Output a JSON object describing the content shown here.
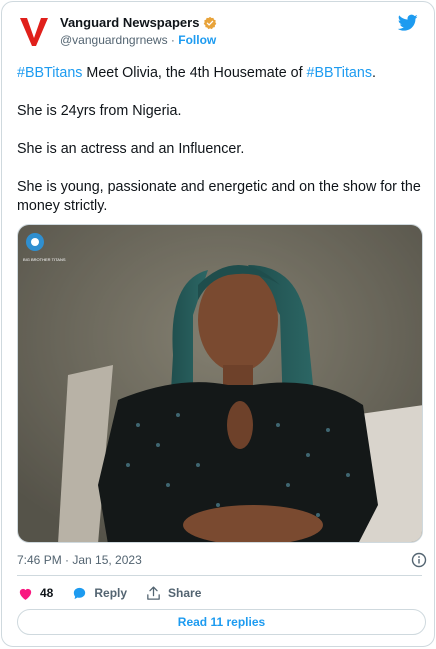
{
  "tweet": {
    "author_name": "Vanguard Newspapers",
    "handle": "@vanguardngrnews",
    "separator": "·",
    "follow_label": "Follow",
    "hashtag": "#BBTitans",
    "first_line_middle": " Meet Olivia, the 4th Housemate of ",
    "first_line_end": ".",
    "paragraphs": [
      "She is 24yrs from Nigeria.",
      "She is an actress and an Influencer.",
      "She is young, passionate and energetic and on the show for the money strictly."
    ],
    "media_watermark": "BIG BROTHER TITANS",
    "timestamp": "7:46 PM · Jan 15, 2023",
    "likes_count": "48",
    "reply_label": "Reply",
    "share_label": "Share",
    "read_replies_label": "Read 11 replies"
  },
  "colors": {
    "brand_red": "#e0201b",
    "link_blue": "#1d9bf0",
    "like_pink": "#f91880",
    "secondary_text": "#536471"
  },
  "icons": [
    "vanguard-logo",
    "verified-badge-icon",
    "twitter-bird-icon",
    "info-icon",
    "heart-icon",
    "reply-icon",
    "share-icon"
  ]
}
